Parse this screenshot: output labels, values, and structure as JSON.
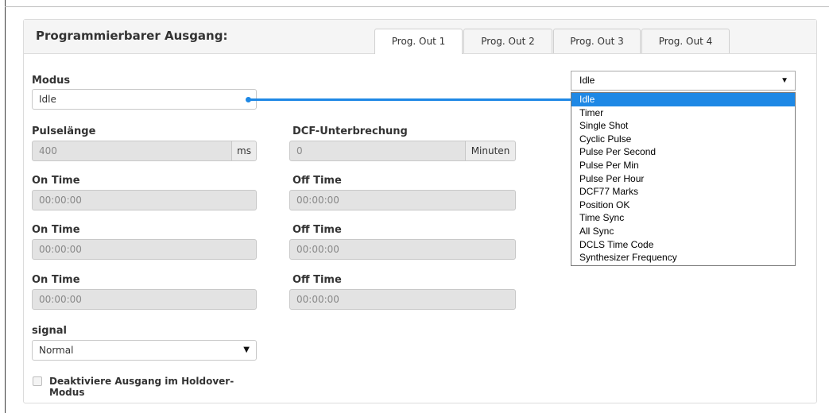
{
  "panel": {
    "title": "Programmierbarer Ausgang:",
    "tabs": [
      {
        "label": "Prog. Out 1",
        "active": true
      },
      {
        "label": "Prog. Out 2",
        "active": false
      },
      {
        "label": "Prog. Out 3",
        "active": false
      },
      {
        "label": "Prog. Out 4",
        "active": false
      }
    ]
  },
  "form": {
    "modus": {
      "label": "Modus",
      "value": "Idle"
    },
    "pulse_length": {
      "label": "Pulselänge",
      "value": "400",
      "unit": "ms"
    },
    "dcf_interrupt": {
      "label": "DCF-Unterbrechung",
      "value": "0",
      "unit": "Minuten"
    },
    "rows": [
      {
        "on_label": "On Time",
        "on_value": "00:00:00",
        "off_label": "Off Time",
        "off_value": "00:00:00"
      },
      {
        "on_label": "On Time",
        "on_value": "00:00:00",
        "off_label": "Off Time",
        "off_value": "00:00:00"
      },
      {
        "on_label": "On Time",
        "on_value": "00:00:00",
        "off_label": "Off Time",
        "off_value": "00:00:00"
      }
    ],
    "signal": {
      "label": "signal",
      "value": "Normal"
    },
    "holdover": {
      "label": "Deaktiviere Ausgang im Holdover-Modus",
      "checked": false
    }
  },
  "dropdown": {
    "selected": "Idle",
    "options": [
      "Idle",
      "Timer",
      "Single Shot",
      "Cyclic Pulse",
      "Pulse Per Second",
      "Pulse Per Min",
      "Pulse Per Hour",
      "DCF77 Marks",
      "Position OK",
      "Time Sync",
      "All Sync",
      "DCLS Time Code",
      "Synthesizer Frequency"
    ],
    "highlighted_index": 0
  },
  "colors": {
    "accent": "#1e88e5",
    "disabled_bg": "#e3e3e3"
  }
}
